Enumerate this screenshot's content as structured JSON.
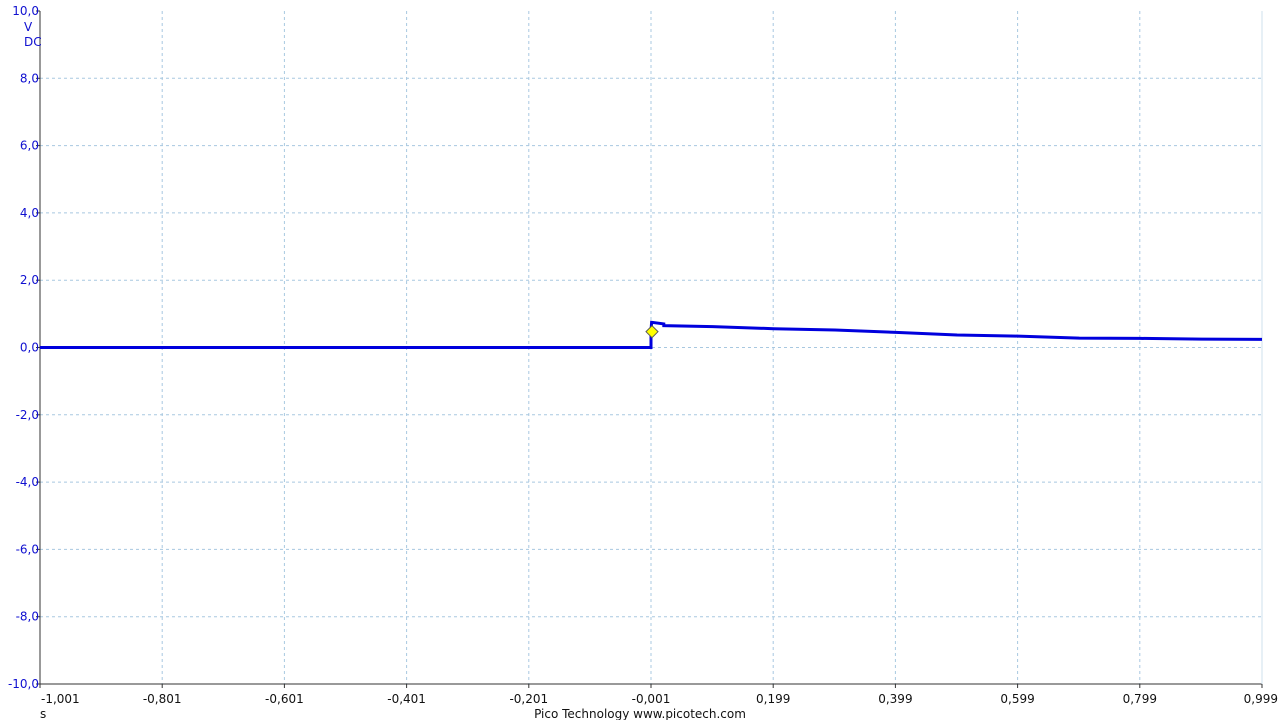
{
  "chart_data": {
    "type": "line",
    "xlim": [
      -1.001,
      0.999
    ],
    "ylim": [
      -10.0,
      10.0
    ],
    "x_ticks": [
      "-1,001",
      "-0,801",
      "-0,601",
      "-0,401",
      "-0,201",
      "-0,001",
      "0,199",
      "0,399",
      "0,599",
      "0,799",
      "0,999"
    ],
    "y_ticks": [
      "10,0",
      "8,0",
      "6,0",
      "4,0",
      "2,0",
      "0,0",
      "-2,0",
      "-4,0",
      "-6,0",
      "-8,0",
      "-10,0"
    ],
    "y_unit": "V",
    "y_coupling": "DC",
    "x_unit": "s",
    "grid": true,
    "series": [
      {
        "color": "#0000dd",
        "x": [
          -1.001,
          -0.001,
          -0.001,
          0.0,
          0.02,
          0.02,
          0.1,
          0.2,
          0.3,
          0.4,
          0.5,
          0.6,
          0.7,
          0.8,
          0.9,
          0.999
        ],
        "y": [
          0.0,
          0.0,
          0.5,
          0.75,
          0.7,
          0.65,
          0.62,
          0.56,
          0.52,
          0.45,
          0.37,
          0.34,
          0.28,
          0.27,
          0.25,
          0.24
        ]
      }
    ],
    "trigger": {
      "x": -0.001,
      "y": 0.47,
      "color": "#ffff00"
    }
  },
  "footer": {
    "credit": "Pico Technology   www.picotech.com"
  }
}
